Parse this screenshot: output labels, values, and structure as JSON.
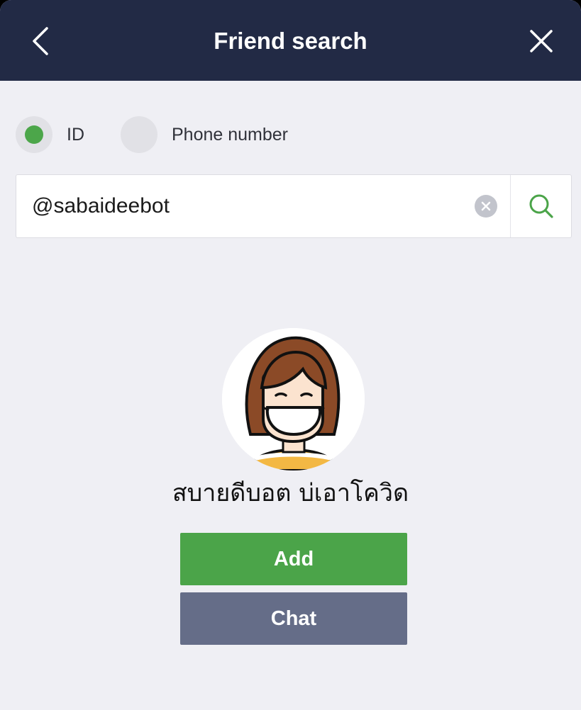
{
  "header": {
    "title": "Friend search"
  },
  "search_type": {
    "options": [
      {
        "label": "ID",
        "selected": true
      },
      {
        "label": "Phone number",
        "selected": false
      }
    ]
  },
  "search": {
    "value": "@sabaideebot"
  },
  "result": {
    "name": "สบายดีบอต บ่เอาโควิด"
  },
  "actions": {
    "add_label": "Add",
    "chat_label": "Chat"
  },
  "colors": {
    "header_bg": "#222a45",
    "accent_green": "#4ba449",
    "chat_button": "#656d88",
    "page_bg": "#efeff4"
  },
  "icons": [
    "back-chevron-icon",
    "close-icon",
    "clear-icon",
    "search-icon"
  ]
}
